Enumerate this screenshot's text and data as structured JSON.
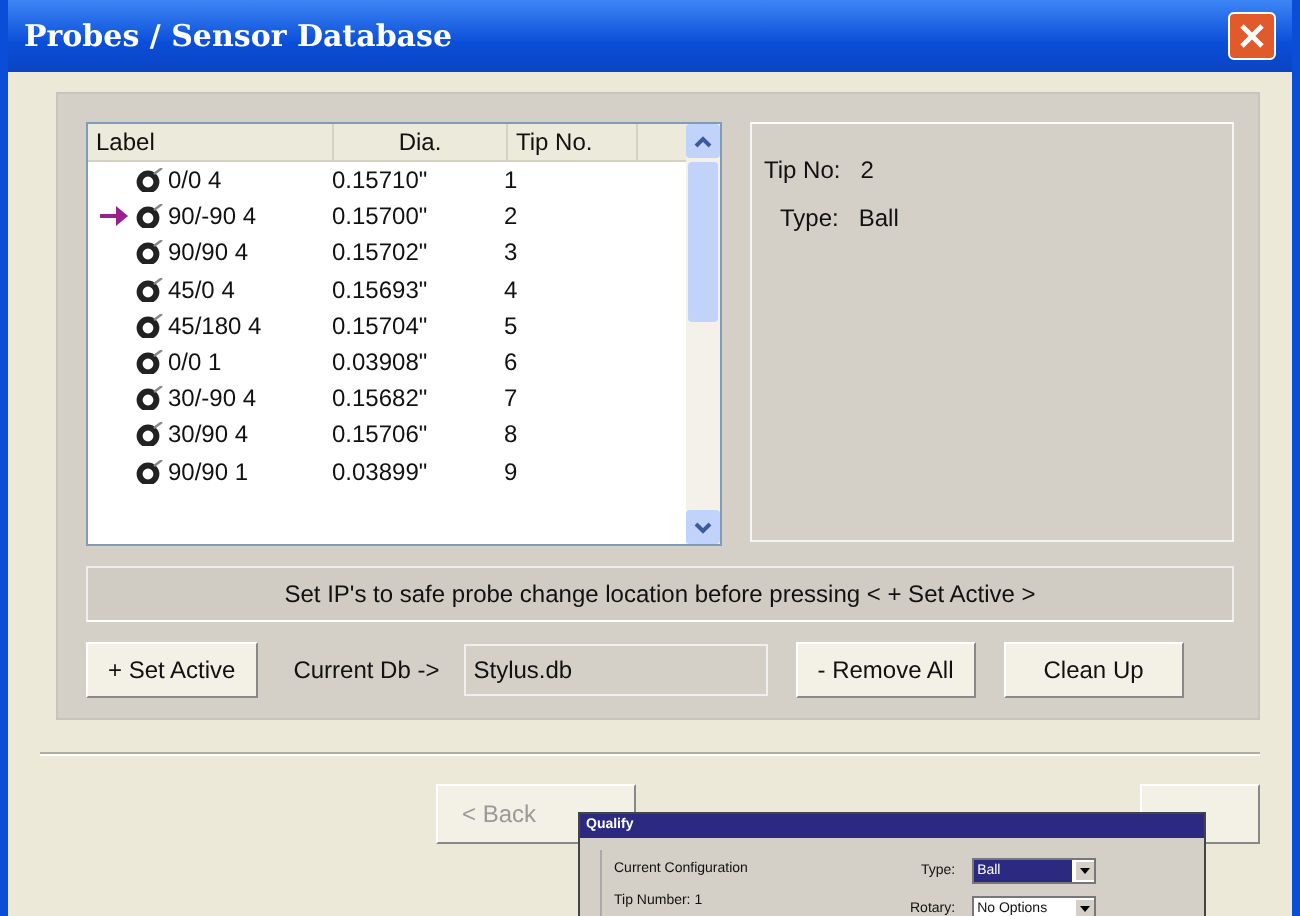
{
  "window": {
    "title": "Probes / Sensor Database"
  },
  "table": {
    "columns": [
      "Label",
      "Dia.",
      "Tip No."
    ],
    "rows": [
      {
        "label": "0/0 4",
        "dia": "0.15710\"",
        "tip": "1",
        "active": false
      },
      {
        "label": "90/-90 4",
        "dia": "0.15700\"",
        "tip": "2",
        "active": true
      },
      {
        "label": "90/90 4",
        "dia": "0.15702\"",
        "tip": "3",
        "active": false
      },
      {
        "label": "45/0 4",
        "dia": "0.15693\"",
        "tip": "4",
        "active": false
      },
      {
        "label": "45/180 4",
        "dia": "0.15704\"",
        "tip": "5",
        "active": false
      },
      {
        "label": "0/0 1",
        "dia": "0.03908\"",
        "tip": "6",
        "active": false
      },
      {
        "label": "30/-90 4",
        "dia": "0.15682\"",
        "tip": "7",
        "active": false
      },
      {
        "label": "30/90 4",
        "dia": "0.15706\"",
        "tip": "8",
        "active": false
      },
      {
        "label": "90/90 1",
        "dia": "0.03899\"",
        "tip": "9",
        "active": false
      }
    ]
  },
  "details": [
    {
      "label": "Tip No:",
      "value": "2"
    },
    {
      "label": "Type:",
      "value": "Ball"
    }
  ],
  "hint": "Set IP's to safe probe change location before pressing  < + Set Active >",
  "set_active_button": "+ Set Active",
  "current_db": {
    "label": "Current Db ->",
    "value": "Stylus.db"
  },
  "remove_all_button": "- Remove All",
  "clean_up_button": "Clean Up",
  "back_button": "< Back",
  "overlay_dialog": {
    "title": "Qualify",
    "group": "Current Configuration",
    "tip_number": "Tip Number: 1",
    "fields": [
      {
        "label": "Type:",
        "value": "Ball",
        "selected": true
      },
      {
        "label": "Rotary:",
        "value": "No Options",
        "selected": false
      }
    ]
  }
}
